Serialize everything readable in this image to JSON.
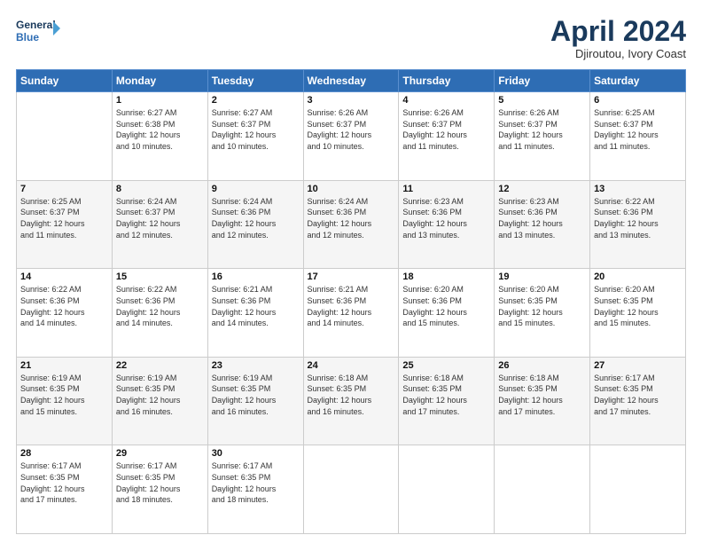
{
  "header": {
    "logo_line1": "General",
    "logo_line2": "Blue",
    "month_title": "April 2024",
    "location": "Djiroutou, Ivory Coast"
  },
  "days_of_week": [
    "Sunday",
    "Monday",
    "Tuesday",
    "Wednesday",
    "Thursday",
    "Friday",
    "Saturday"
  ],
  "weeks": [
    [
      {
        "num": "",
        "info": ""
      },
      {
        "num": "1",
        "info": "Sunrise: 6:27 AM\nSunset: 6:38 PM\nDaylight: 12 hours\nand 10 minutes."
      },
      {
        "num": "2",
        "info": "Sunrise: 6:27 AM\nSunset: 6:37 PM\nDaylight: 12 hours\nand 10 minutes."
      },
      {
        "num": "3",
        "info": "Sunrise: 6:26 AM\nSunset: 6:37 PM\nDaylight: 12 hours\nand 10 minutes."
      },
      {
        "num": "4",
        "info": "Sunrise: 6:26 AM\nSunset: 6:37 PM\nDaylight: 12 hours\nand 11 minutes."
      },
      {
        "num": "5",
        "info": "Sunrise: 6:26 AM\nSunset: 6:37 PM\nDaylight: 12 hours\nand 11 minutes."
      },
      {
        "num": "6",
        "info": "Sunrise: 6:25 AM\nSunset: 6:37 PM\nDaylight: 12 hours\nand 11 minutes."
      }
    ],
    [
      {
        "num": "7",
        "info": "Sunrise: 6:25 AM\nSunset: 6:37 PM\nDaylight: 12 hours\nand 11 minutes."
      },
      {
        "num": "8",
        "info": "Sunrise: 6:24 AM\nSunset: 6:37 PM\nDaylight: 12 hours\nand 12 minutes."
      },
      {
        "num": "9",
        "info": "Sunrise: 6:24 AM\nSunset: 6:36 PM\nDaylight: 12 hours\nand 12 minutes."
      },
      {
        "num": "10",
        "info": "Sunrise: 6:24 AM\nSunset: 6:36 PM\nDaylight: 12 hours\nand 12 minutes."
      },
      {
        "num": "11",
        "info": "Sunrise: 6:23 AM\nSunset: 6:36 PM\nDaylight: 12 hours\nand 13 minutes."
      },
      {
        "num": "12",
        "info": "Sunrise: 6:23 AM\nSunset: 6:36 PM\nDaylight: 12 hours\nand 13 minutes."
      },
      {
        "num": "13",
        "info": "Sunrise: 6:22 AM\nSunset: 6:36 PM\nDaylight: 12 hours\nand 13 minutes."
      }
    ],
    [
      {
        "num": "14",
        "info": "Sunrise: 6:22 AM\nSunset: 6:36 PM\nDaylight: 12 hours\nand 14 minutes."
      },
      {
        "num": "15",
        "info": "Sunrise: 6:22 AM\nSunset: 6:36 PM\nDaylight: 12 hours\nand 14 minutes."
      },
      {
        "num": "16",
        "info": "Sunrise: 6:21 AM\nSunset: 6:36 PM\nDaylight: 12 hours\nand 14 minutes."
      },
      {
        "num": "17",
        "info": "Sunrise: 6:21 AM\nSunset: 6:36 PM\nDaylight: 12 hours\nand 14 minutes."
      },
      {
        "num": "18",
        "info": "Sunrise: 6:20 AM\nSunset: 6:36 PM\nDaylight: 12 hours\nand 15 minutes."
      },
      {
        "num": "19",
        "info": "Sunrise: 6:20 AM\nSunset: 6:35 PM\nDaylight: 12 hours\nand 15 minutes."
      },
      {
        "num": "20",
        "info": "Sunrise: 6:20 AM\nSunset: 6:35 PM\nDaylight: 12 hours\nand 15 minutes."
      }
    ],
    [
      {
        "num": "21",
        "info": "Sunrise: 6:19 AM\nSunset: 6:35 PM\nDaylight: 12 hours\nand 15 minutes."
      },
      {
        "num": "22",
        "info": "Sunrise: 6:19 AM\nSunset: 6:35 PM\nDaylight: 12 hours\nand 16 minutes."
      },
      {
        "num": "23",
        "info": "Sunrise: 6:19 AM\nSunset: 6:35 PM\nDaylight: 12 hours\nand 16 minutes."
      },
      {
        "num": "24",
        "info": "Sunrise: 6:18 AM\nSunset: 6:35 PM\nDaylight: 12 hours\nand 16 minutes."
      },
      {
        "num": "25",
        "info": "Sunrise: 6:18 AM\nSunset: 6:35 PM\nDaylight: 12 hours\nand 17 minutes."
      },
      {
        "num": "26",
        "info": "Sunrise: 6:18 AM\nSunset: 6:35 PM\nDaylight: 12 hours\nand 17 minutes."
      },
      {
        "num": "27",
        "info": "Sunrise: 6:17 AM\nSunset: 6:35 PM\nDaylight: 12 hours\nand 17 minutes."
      }
    ],
    [
      {
        "num": "28",
        "info": "Sunrise: 6:17 AM\nSunset: 6:35 PM\nDaylight: 12 hours\nand 17 minutes."
      },
      {
        "num": "29",
        "info": "Sunrise: 6:17 AM\nSunset: 6:35 PM\nDaylight: 12 hours\nand 18 minutes."
      },
      {
        "num": "30",
        "info": "Sunrise: 6:17 AM\nSunset: 6:35 PM\nDaylight: 12 hours\nand 18 minutes."
      },
      {
        "num": "",
        "info": ""
      },
      {
        "num": "",
        "info": ""
      },
      {
        "num": "",
        "info": ""
      },
      {
        "num": "",
        "info": ""
      }
    ]
  ]
}
